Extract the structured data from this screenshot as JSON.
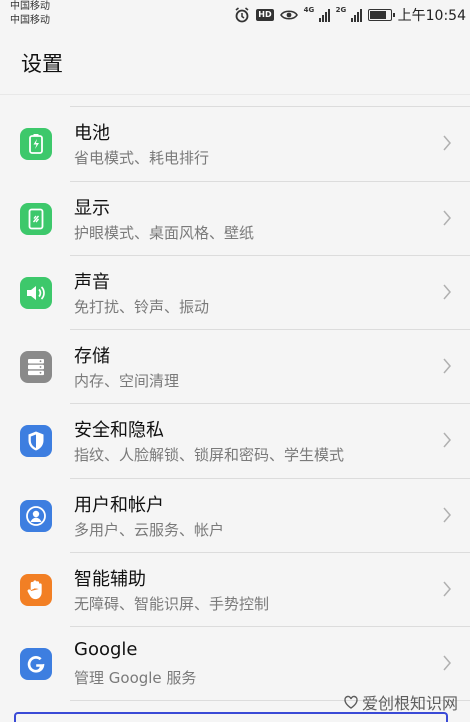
{
  "status_bar": {
    "carrier_1": "中国移动",
    "carrier_2": "中国移动",
    "hd": "HD",
    "net_1": "4G",
    "net_2": "2G",
    "time": "上午10:54"
  },
  "header": {
    "title": "设置"
  },
  "items": [
    {
      "title": "电池",
      "subtitle": "省电模式、耗电排行",
      "icon": "battery-icon",
      "color": "#3dc86b"
    },
    {
      "title": "显示",
      "subtitle": "护眼模式、桌面风格、壁纸",
      "icon": "display-icon",
      "color": "#3dc86b"
    },
    {
      "title": "声音",
      "subtitle": "免打扰、铃声、振动",
      "icon": "sound-icon",
      "color": "#3dc86b"
    },
    {
      "title": "存储",
      "subtitle": "内存、空间清理",
      "icon": "storage-icon",
      "color": "#8a8a8a"
    },
    {
      "title": "安全和隐私",
      "subtitle": "指纹、人脸解锁、锁屏和密码、学生模式",
      "icon": "shield-icon",
      "color": "#3d7ee0"
    },
    {
      "title": "用户和帐户",
      "subtitle": "多用户、云服务、帐户",
      "icon": "user-icon",
      "color": "#3d7ee0"
    },
    {
      "title": "智能辅助",
      "subtitle": "无障碍、智能识屏、手势控制",
      "icon": "hand-icon",
      "color": "#f27f24"
    },
    {
      "title": "Google",
      "subtitle": "管理 Google 服务",
      "icon": "google-icon",
      "color": "#3d7ee0"
    }
  ],
  "watermark": "爱创根知识网"
}
